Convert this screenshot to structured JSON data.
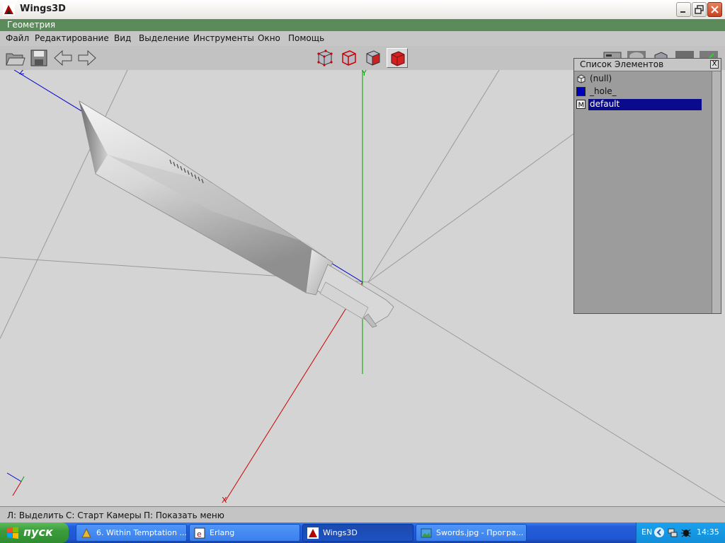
{
  "window": {
    "title": "Wings3D"
  },
  "geometry_bar": {
    "label": "Геометрия"
  },
  "menu": [
    "Файл",
    "Редактирование",
    "Вид",
    "Выделение",
    "Инструменты",
    "Окно",
    "Помощь"
  ],
  "toolbar": {
    "file_buttons": [
      "open-icon",
      "save-icon",
      "undo-icon",
      "redo-icon"
    ],
    "selection_modes": [
      "vertex",
      "edge",
      "face",
      "body"
    ],
    "active_mode": "body"
  },
  "viewport": {
    "axis_labels": {
      "y": "Y",
      "x": "X",
      "z": "Z"
    },
    "colors": {
      "x_axis": "#cc0000",
      "y_axis": "#00aa00",
      "z_axis": "#0000cc",
      "background": "#d4d4d4"
    }
  },
  "outliner": {
    "title": "Список Элементов",
    "close_label": "X",
    "items": [
      {
        "label": "(null)",
        "icon": "cube-icon",
        "selected": false
      },
      {
        "label": "_hole_",
        "icon": "material-swatch-icon",
        "selected": false
      },
      {
        "label": "default",
        "icon": "material-m-icon",
        "icon_text": "M",
        "selected": true
      }
    ]
  },
  "status": {
    "left": "Л: Выделить",
    "middle": "С: Старт Камеры",
    "right": "П: Показать меню"
  },
  "taskbar": {
    "start_label": "пуск",
    "tasks": [
      {
        "label": "6. Within Temptation ...",
        "active": false
      },
      {
        "label": "Erlang",
        "active": false
      },
      {
        "label": "Wings3D",
        "active": true
      },
      {
        "label": "Swords.jpg - Програ...",
        "active": false
      }
    ],
    "tray": {
      "lang": "EN",
      "time": "14:35"
    }
  }
}
